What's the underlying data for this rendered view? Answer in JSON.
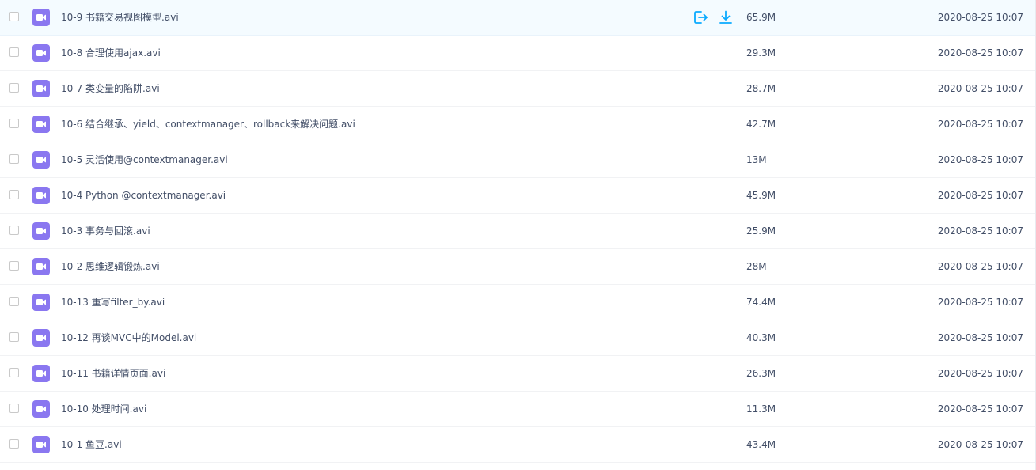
{
  "colors": {
    "video_icon": "#8a77f0",
    "action_icon": "#09aaff",
    "text": "#424e67",
    "row_hover_bg": "#f4fbff"
  },
  "row_actions": {
    "share_icon": "share-out-icon",
    "download_icon": "download-icon"
  },
  "files": [
    {
      "name": "10-9 书籍交易视图模型.avi",
      "size": "65.9M",
      "date": "2020-08-25 10:07",
      "icon": "video-file-icon",
      "hovered": true
    },
    {
      "name": "10-8 合理使用ajax.avi",
      "size": "29.3M",
      "date": "2020-08-25 10:07",
      "icon": "video-file-icon"
    },
    {
      "name": "10-7 类变量的陷阱.avi",
      "size": "28.7M",
      "date": "2020-08-25 10:07",
      "icon": "video-file-icon"
    },
    {
      "name": "10-6 结合继承、yield、contextmanager、rollback来解决问题.avi",
      "size": "42.7M",
      "date": "2020-08-25 10:07",
      "icon": "video-file-icon"
    },
    {
      "name": "10-5 灵活使用@contextmanager.avi",
      "size": "13M",
      "date": "2020-08-25 10:07",
      "icon": "video-file-icon"
    },
    {
      "name": "10-4 Python @contextmanager.avi",
      "size": "45.9M",
      "date": "2020-08-25 10:07",
      "icon": "video-file-icon"
    },
    {
      "name": "10-3 事务与回滚.avi",
      "size": "25.9M",
      "date": "2020-08-25 10:07",
      "icon": "video-file-icon"
    },
    {
      "name": "10-2 思维逻辑锻炼.avi",
      "size": "28M",
      "date": "2020-08-25 10:07",
      "icon": "video-file-icon"
    },
    {
      "name": "10-13 重写filter_by.avi",
      "size": "74.4M",
      "date": "2020-08-25 10:07",
      "icon": "video-file-icon"
    },
    {
      "name": "10-12 再谈MVC中的Model.avi",
      "size": "40.3M",
      "date": "2020-08-25 10:07",
      "icon": "video-file-icon"
    },
    {
      "name": "10-11 书籍详情页面.avi",
      "size": "26.3M",
      "date": "2020-08-25 10:07",
      "icon": "video-file-icon"
    },
    {
      "name": "10-10 处理时间.avi",
      "size": "11.3M",
      "date": "2020-08-25 10:07",
      "icon": "video-file-icon"
    },
    {
      "name": "10-1 鱼豆.avi",
      "size": "43.4M",
      "date": "2020-08-25 10:07",
      "icon": "video-file-icon"
    }
  ]
}
